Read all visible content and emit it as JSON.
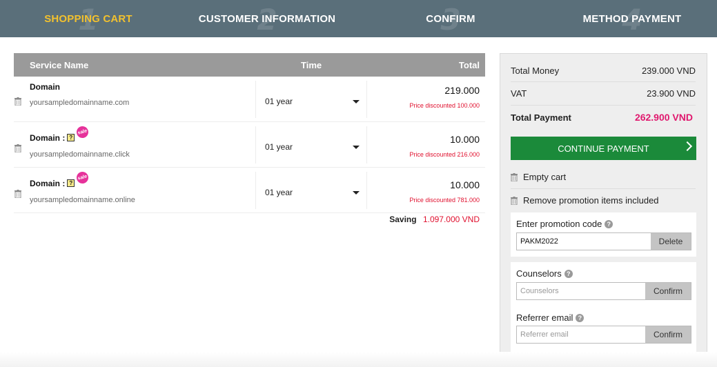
{
  "steps": [
    {
      "num": "1",
      "label": "SHOPPING CART",
      "active": true
    },
    {
      "num": "2",
      "label": "CUSTOMER INFORMATION",
      "active": false
    },
    {
      "num": "3",
      "label": "CONFIRM",
      "active": false
    },
    {
      "num": "4",
      "label": "METHOD PAYMENT",
      "active": false
    }
  ],
  "cart": {
    "headers": {
      "service": "Service Name",
      "time": "Time",
      "total": "Total"
    },
    "items": [
      {
        "name": "Domain",
        "domain": "yoursampledomainname.com",
        "time": "01 year",
        "price": "219.000",
        "discount": "Price discounted 100.000"
      },
      {
        "name": "Domain :",
        "sale": "sale",
        "domain": "yoursampledomainname.click",
        "time": "01 year",
        "price": "10.000",
        "discount": "Price discounted 216.000"
      },
      {
        "name": "Domain :",
        "sale": "sale",
        "domain": "yoursampledomainname.online",
        "time": "01 year",
        "price": "10.000",
        "discount": "Price discounted 781.000"
      }
    ],
    "saving_label": "Saving",
    "saving_value": "1.097.000 VND"
  },
  "summary": {
    "total_money_label": "Total Money",
    "total_money_value": "239.000 VND",
    "vat_label": "VAT",
    "vat_value": "23.900 VND",
    "total_payment_label": "Total Payment",
    "total_payment_value": "262.900 VND",
    "continue_label": "CONTINUE PAYMENT",
    "empty_cart_label": "Empty cart",
    "remove_promo_label": "Remove promotion items included",
    "promo_title": "Enter promotion code",
    "promo_value": "PAKM2022",
    "promo_delete_label": "Delete",
    "counselors_title": "Counselors",
    "counselors_placeholder": "Counselors",
    "counselors_confirm_label": "Confirm",
    "referrer_title": "Referrer email",
    "referrer_placeholder": "Referrer email",
    "referrer_confirm_label": "Confirm"
  },
  "colors": {
    "header_bg": "#5a6f7a",
    "active_step": "#f2c12e",
    "continue_button": "#1b8a3a",
    "total_payment": "#e0186e",
    "discount_red": "#e0102e"
  },
  "icons": {
    "trash": "trash-icon",
    "help": "help-icon",
    "sale_badge": "sale-badge",
    "note": "question-note-icon",
    "chevron": "chevron-right-icon"
  }
}
